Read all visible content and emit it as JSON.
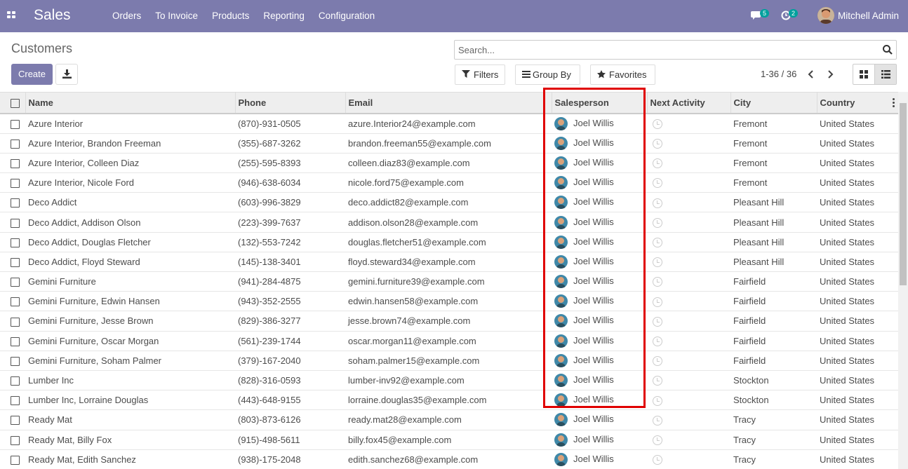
{
  "topbar": {
    "app_title": "Sales",
    "menu": [
      "Orders",
      "To Invoice",
      "Products",
      "Reporting",
      "Configuration"
    ],
    "messages_count": "5",
    "activities_count": "2",
    "user_name": "Mitchell Admin",
    "bg_color": "#7c7bad"
  },
  "control_panel": {
    "title": "Customers",
    "create_label": "Create",
    "search_placeholder": "Search...",
    "filters_label": "Filters",
    "group_by_label": "Group By",
    "favorites_label": "Favorites",
    "pager": "1-36 / 36"
  },
  "table": {
    "columns": [
      "Name",
      "Phone",
      "Email",
      "Salesperson",
      "Next Activity",
      "City",
      "Country"
    ],
    "rows": [
      {
        "name": "Azure Interior",
        "phone": "(870)-931-0505",
        "email": "azure.Interior24@example.com",
        "salesperson": "Joel Willis",
        "city": "Fremont",
        "country": "United States"
      },
      {
        "name": "Azure Interior, Brandon Freeman",
        "phone": "(355)-687-3262",
        "email": "brandon.freeman55@example.com",
        "salesperson": "Joel Willis",
        "city": "Fremont",
        "country": "United States"
      },
      {
        "name": "Azure Interior, Colleen Diaz",
        "phone": "(255)-595-8393",
        "email": "colleen.diaz83@example.com",
        "salesperson": "Joel Willis",
        "city": "Fremont",
        "country": "United States"
      },
      {
        "name": "Azure Interior, Nicole Ford",
        "phone": "(946)-638-6034",
        "email": "nicole.ford75@example.com",
        "salesperson": "Joel Willis",
        "city": "Fremont",
        "country": "United States"
      },
      {
        "name": "Deco Addict",
        "phone": "(603)-996-3829",
        "email": "deco.addict82@example.com",
        "salesperson": "Joel Willis",
        "city": "Pleasant Hill",
        "country": "United States"
      },
      {
        "name": "Deco Addict, Addison Olson",
        "phone": "(223)-399-7637",
        "email": "addison.olson28@example.com",
        "salesperson": "Joel Willis",
        "city": "Pleasant Hill",
        "country": "United States"
      },
      {
        "name": "Deco Addict, Douglas Fletcher",
        "phone": "(132)-553-7242",
        "email": "douglas.fletcher51@example.com",
        "salesperson": "Joel Willis",
        "city": "Pleasant Hill",
        "country": "United States"
      },
      {
        "name": "Deco Addict, Floyd Steward",
        "phone": "(145)-138-3401",
        "email": "floyd.steward34@example.com",
        "salesperson": "Joel Willis",
        "city": "Pleasant Hill",
        "country": "United States"
      },
      {
        "name": "Gemini Furniture",
        "phone": "(941)-284-4875",
        "email": "gemini.furniture39@example.com",
        "salesperson": "Joel Willis",
        "city": "Fairfield",
        "country": "United States"
      },
      {
        "name": "Gemini Furniture, Edwin Hansen",
        "phone": "(943)-352-2555",
        "email": "edwin.hansen58@example.com",
        "salesperson": "Joel Willis",
        "city": "Fairfield",
        "country": "United States"
      },
      {
        "name": "Gemini Furniture, Jesse Brown",
        "phone": "(829)-386-3277",
        "email": "jesse.brown74@example.com",
        "salesperson": "Joel Willis",
        "city": "Fairfield",
        "country": "United States"
      },
      {
        "name": "Gemini Furniture, Oscar Morgan",
        "phone": "(561)-239-1744",
        "email": "oscar.morgan11@example.com",
        "salesperson": "Joel Willis",
        "city": "Fairfield",
        "country": "United States"
      },
      {
        "name": "Gemini Furniture, Soham Palmer",
        "phone": "(379)-167-2040",
        "email": "soham.palmer15@example.com",
        "salesperson": "Joel Willis",
        "city": "Fairfield",
        "country": "United States"
      },
      {
        "name": "Lumber Inc",
        "phone": "(828)-316-0593",
        "email": "lumber-inv92@example.com",
        "salesperson": "Joel Willis",
        "city": "Stockton",
        "country": "United States"
      },
      {
        "name": "Lumber Inc, Lorraine Douglas",
        "phone": "(443)-648-9155",
        "email": "lorraine.douglas35@example.com",
        "salesperson": "Joel Willis",
        "city": "Stockton",
        "country": "United States"
      },
      {
        "name": "Ready Mat",
        "phone": "(803)-873-6126",
        "email": "ready.mat28@example.com",
        "salesperson": "Joel Willis",
        "city": "Tracy",
        "country": "United States"
      },
      {
        "name": "Ready Mat, Billy Fox",
        "phone": "(915)-498-5611",
        "email": "billy.fox45@example.com",
        "salesperson": "Joel Willis",
        "city": "Tracy",
        "country": "United States"
      },
      {
        "name": "Ready Mat, Edith Sanchez",
        "phone": "(938)-175-2048",
        "email": "edith.sanchez68@example.com",
        "salesperson": "Joel Willis",
        "city": "Tracy",
        "country": "United States"
      }
    ]
  },
  "highlight_color": "#e00000"
}
